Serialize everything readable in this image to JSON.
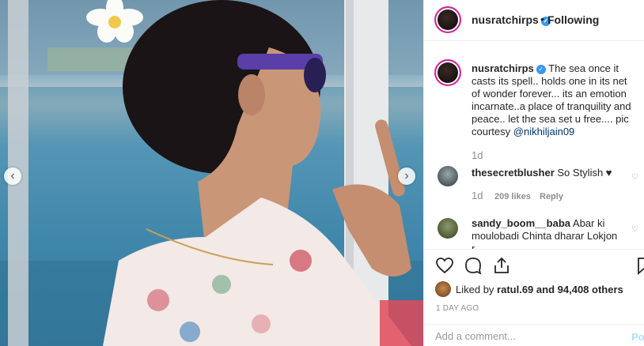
{
  "post": {
    "author": "nusratchirps",
    "verified_icon": "verified-badge-icon",
    "follow_status": "Following",
    "caption_text": "The sea once it casts its spell.. holds one in its net of wonder forever... its an emotion incarnate..a place of tranquility and peace.. let the sea set u free.... pic courtesy",
    "caption_mention": "@nikhiljain09",
    "caption_time": "1d"
  },
  "comments": [
    {
      "user": "thesecretblusher",
      "text": "So Stylish ♥",
      "time": "1d",
      "likes": "209 likes",
      "reply": "Reply"
    },
    {
      "user": "sandy_boom__baba",
      "text": "Abar ki moulobadi Chinta dharar Lokjon r"
    }
  ],
  "actions": {
    "icons": [
      "heart-icon",
      "comment-icon",
      "share-icon",
      "bookmark-icon"
    ],
    "likes_prefix": "Liked by",
    "likes_user": "ratul.69",
    "likes_suffix": "and 94,408 others",
    "date": "1 DAY AGO",
    "comment_placeholder": "Add a comment...",
    "post_label": "Post"
  },
  "photo": {
    "prev_arrow": "‹",
    "next_arrow": "›"
  },
  "colors": {
    "verified": "#3897f0",
    "mention": "#003569",
    "muted": "#8e8e8e",
    "post_disabled": "#b2dffc"
  }
}
